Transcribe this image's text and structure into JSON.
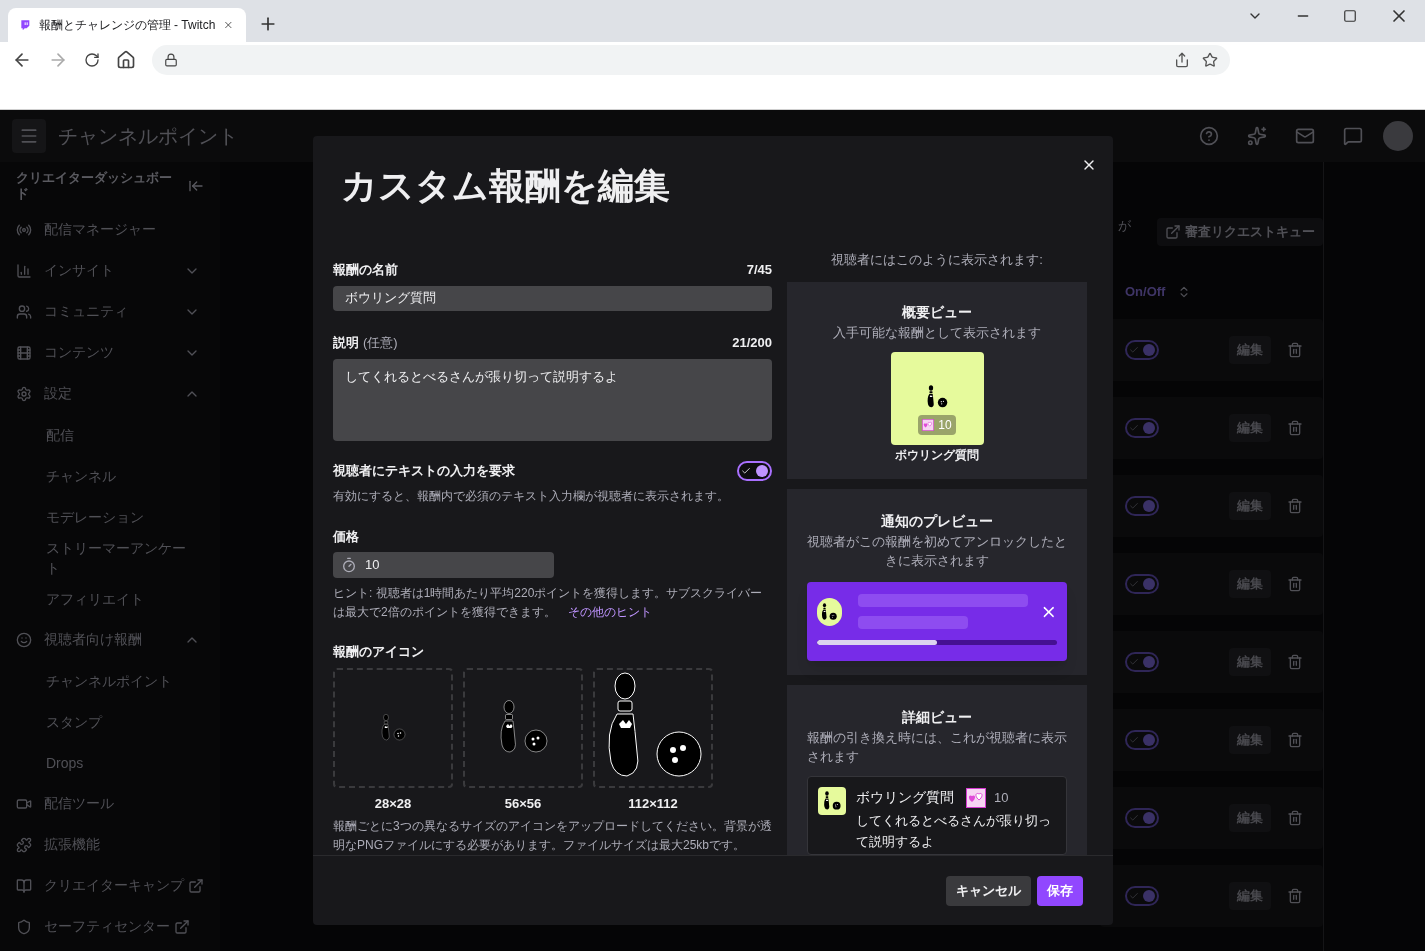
{
  "browser": {
    "tab_title": "報酬とチャレンジの管理 - Twitch"
  },
  "app": {
    "page_title": "チャンネルポイント",
    "sidebar": {
      "header": "クリエイターダッシュボード",
      "items": [
        {
          "label": "配信マネージャー",
          "kind": "link"
        },
        {
          "label": "インサイト",
          "kind": "group",
          "expanded": false
        },
        {
          "label": "コミュニティ",
          "kind": "group",
          "expanded": false
        },
        {
          "label": "コンテンツ",
          "kind": "group",
          "expanded": false
        },
        {
          "label": "設定",
          "kind": "group",
          "expanded": true,
          "children": [
            {
              "label": "配信"
            },
            {
              "label": "チャンネル"
            },
            {
              "label": "モデレーション"
            },
            {
              "label": "ストリーマーアンケート"
            },
            {
              "label": "アフィリエイト"
            }
          ]
        },
        {
          "label": "視聴者向け報酬",
          "kind": "group",
          "expanded": true,
          "children": [
            {
              "label": "チャンネルポイント"
            },
            {
              "label": "スタンプ"
            },
            {
              "label": "Drops"
            }
          ]
        },
        {
          "label": "配信ツール",
          "kind": "link"
        },
        {
          "label": "拡張機能",
          "kind": "link"
        },
        {
          "label": "クリエイターキャンプ",
          "kind": "external"
        },
        {
          "label": "セーフティセンター",
          "kind": "external"
        }
      ]
    },
    "main": {
      "fragment": "が",
      "review_button": "審査リクエストキュー",
      "column": "On/Off",
      "rows": [
        {
          "on": true,
          "edit": "編集"
        },
        {
          "on": true,
          "edit": "編集"
        },
        {
          "on": true,
          "edit": "編集"
        },
        {
          "on": true,
          "edit": "編集"
        },
        {
          "on": true,
          "edit": "編集"
        },
        {
          "on": true,
          "edit": "編集"
        },
        {
          "on": true,
          "edit": "編集"
        },
        {
          "on": true,
          "edit": "編集"
        }
      ]
    }
  },
  "modal": {
    "title": "カスタム報酬を編集",
    "name": {
      "label": "報酬の名前",
      "counter": "7/45",
      "value": "ボウリング質問"
    },
    "description": {
      "label": "説明",
      "optional": "(任意)",
      "counter": "21/200",
      "value": "してくれるとべるさんが張り切って説明するよ"
    },
    "require_text": {
      "label": "視聴者にテキストの入力を要求",
      "on": true,
      "help": "有効にすると、報酬内で必須のテキスト入力欄が視聴者に表示されます。"
    },
    "price": {
      "label": "価格",
      "value": "10",
      "hint": "ヒント: 視聴者は1時間あたり平均220ポイントを獲得します。サブスクライバーは最大で2倍のポイントを獲得できます。",
      "hint_link": "その他のヒント"
    },
    "icons": {
      "label": "報酬のアイコン",
      "sizes": [
        "28×28",
        "56×56",
        "112×112"
      ],
      "help": "報酬ごとに3つの異なるサイズのアイコンをアップロードしてください。背景が透明なPNGファイルにする必要があります。ファイルサイズは最大25kbです。"
    },
    "preview_heading": "視聴者にはこのように表示されます:",
    "summary": {
      "title": "概要ビュー",
      "subtitle": "入手可能な報酬として表示されます",
      "cost": "10",
      "name": "ボウリング質問"
    },
    "notification": {
      "title": "通知のプレビュー",
      "subtitle": "視聴者がこの報酬を初めてアンロックしたときに表示されます",
      "level": 0.5
    },
    "detail": {
      "title": "詳細ビュー",
      "subtitle": "報酬の引き換え時には、これが視聴者に表示されます",
      "name": "ボウリング質問",
      "cost": "10",
      "description": "してくれるとべるさんが張り切って説明するよ"
    },
    "buttons": {
      "cancel": "キャンセル",
      "save": "保存"
    }
  }
}
